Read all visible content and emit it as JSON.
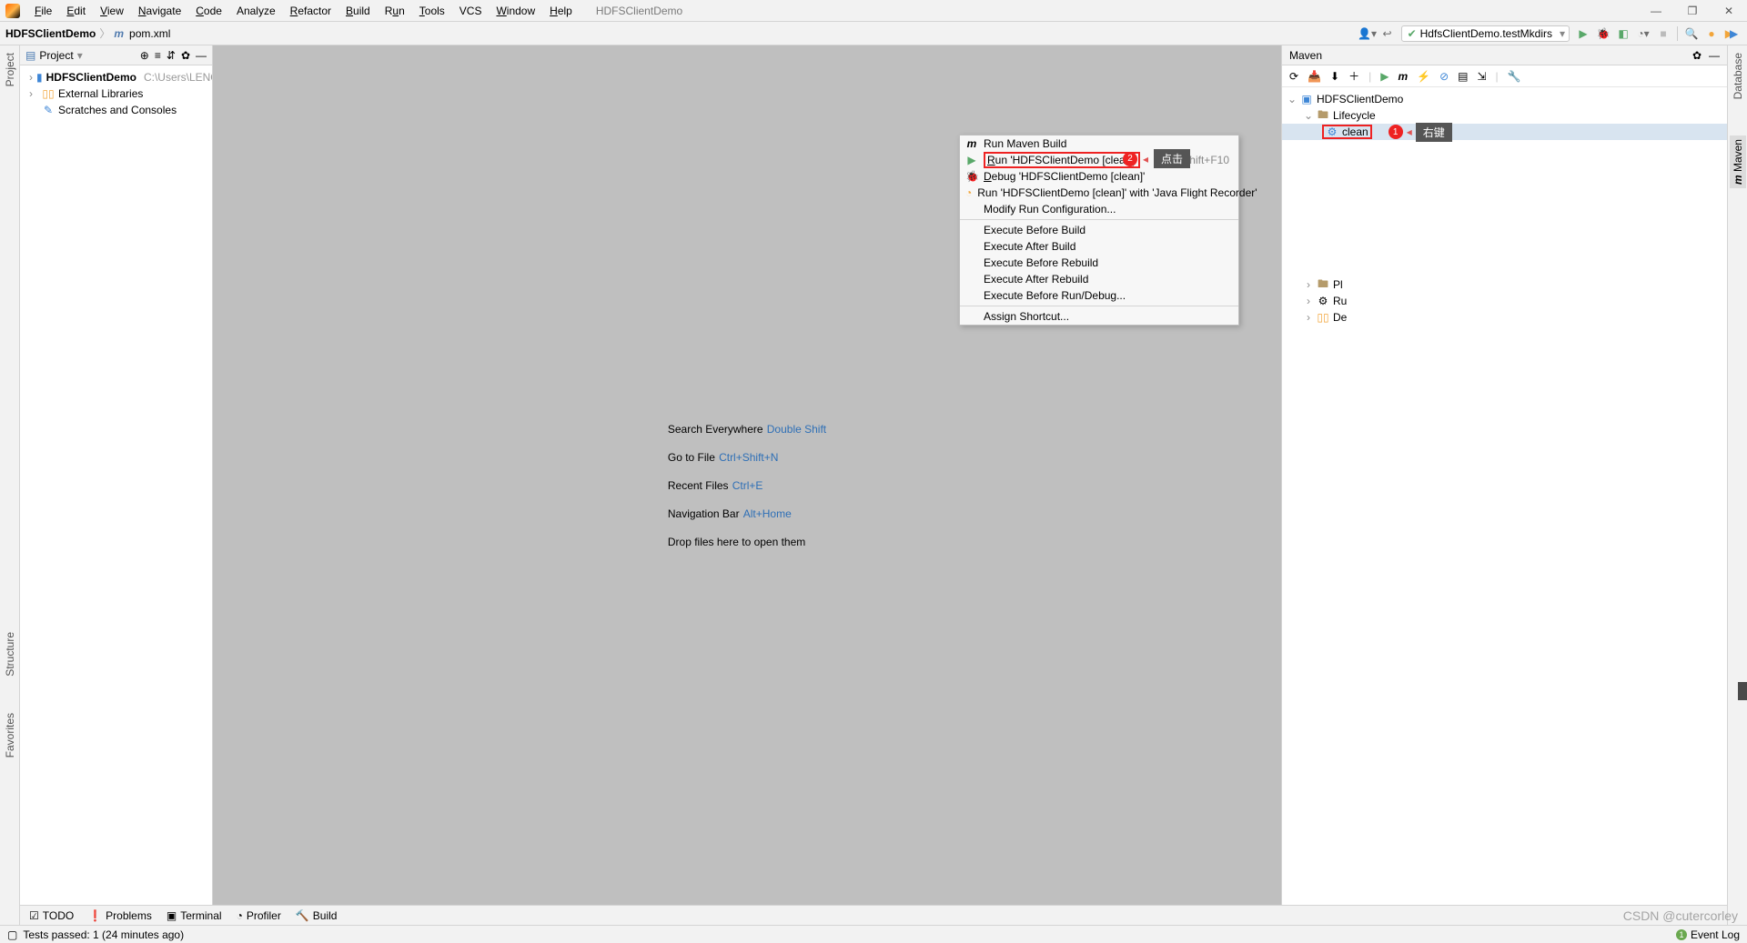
{
  "menu": {
    "file": "File",
    "edit": "Edit",
    "view": "View",
    "navigate": "Navigate",
    "code": "Code",
    "analyze": "Analyze",
    "refactor": "Refactor",
    "build": "Build",
    "run": "Run",
    "tools": "Tools",
    "vcs": "VCS",
    "window": "Window",
    "help": "Help",
    "title": "HDFSClientDemo"
  },
  "breadcrumb": {
    "root": "HDFSClientDemo",
    "file": "pom.xml"
  },
  "runcfg": {
    "name": "HdfsClientDemo.testMkdirs"
  },
  "project": {
    "header": "Project",
    "items": [
      {
        "name": "HDFSClientDemo",
        "path": "C:\\Users\\LENOVO"
      },
      {
        "name": "External Libraries"
      },
      {
        "name": "Scratches and Consoles"
      }
    ]
  },
  "welcome": {
    "search": "Search Everywhere",
    "search_kb": "Double Shift",
    "goto": "Go to File",
    "goto_kb": "Ctrl+Shift+N",
    "recent": "Recent Files",
    "recent_kb": "Ctrl+E",
    "nav": "Navigation Bar",
    "nav_kb": "Alt+Home",
    "drop": "Drop files here to open them"
  },
  "maven": {
    "title": "Maven",
    "root": "HDFSClientDemo",
    "lifecycle": "Lifecycle",
    "clean": "clean",
    "plugins": "Pl",
    "runconfigs": "Ru",
    "deps": "De",
    "tip1": "右键",
    "tip2": "点击"
  },
  "ctx": {
    "runmaven": "Run Maven Build",
    "run": "Run 'HDFSClientDemo [clean]'",
    "run_sc": "Ctrl+Shift+F10",
    "debug": "Debug 'HDFSClientDemo [clean]'",
    "jfr": "Run 'HDFSClientDemo [clean]' with 'Java Flight Recorder'",
    "modify": "Modify Run Configuration...",
    "beforebuild": "Execute Before Build",
    "afterbuild": "Execute After Build",
    "beforerebuild": "Execute Before Rebuild",
    "afterrebuild": "Execute After Rebuild",
    "beforerun": "Execute Before Run/Debug...",
    "shortcut": "Assign Shortcut..."
  },
  "gutter": {
    "project": "Project",
    "structure": "Structure",
    "favorites": "Favorites",
    "database": "Database",
    "maven": "Maven"
  },
  "bottom": {
    "todo": "TODO",
    "problems": "Problems",
    "terminal": "Terminal",
    "profiler": "Profiler",
    "build": "Build"
  },
  "status": {
    "tests": "Tests passed: 1 (24 minutes ago)",
    "eventlog": "Event Log"
  },
  "badges": {
    "b1": "1",
    "b2": "2"
  },
  "watermark": "CSDN @cutercorley"
}
